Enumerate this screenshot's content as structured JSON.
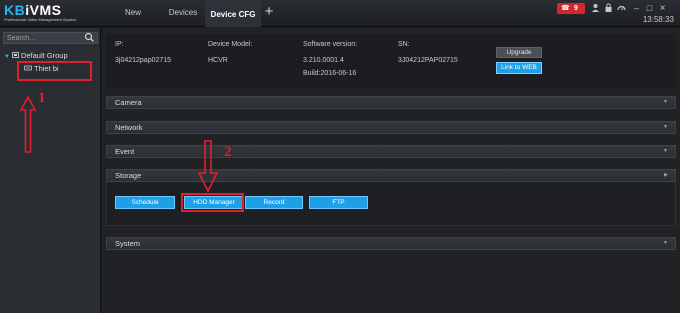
{
  "app": {
    "logo_main_k": "KB",
    "logo_main_rest": "iVMS",
    "logo_sub": "Professional Video Management System"
  },
  "tabs": [
    {
      "label": "New"
    },
    {
      "label": "Devices"
    },
    {
      "label": "Device CFG"
    }
  ],
  "topbar": {
    "add_tab": "+",
    "alarm_count": "9",
    "clock": "13:58:33"
  },
  "sidebar": {
    "search_placeholder": "Search...",
    "group_label": "Default Group",
    "device_label": "Thiet bi"
  },
  "device_info": {
    "ip_label": "IP:",
    "ip_value": "3j04212pap02715",
    "model_label": "Device Model:",
    "model_value": "HCVR",
    "sw_label": "Software version:",
    "sw_value": "3.210.0001.4",
    "build_value": "Build:2016-06-16",
    "sn_label": "SN:",
    "sn_value": "3J04212PAP02715",
    "upgrade_label": "Upgrade",
    "web_label": "Link to WEB"
  },
  "sections": [
    {
      "title": "Camera"
    },
    {
      "title": "Network"
    },
    {
      "title": "Event"
    },
    {
      "title": "Storage"
    },
    {
      "title": "System"
    }
  ],
  "storage_buttons": [
    {
      "label": "Schedule"
    },
    {
      "label": "HDD Manager"
    },
    {
      "label": "Record"
    },
    {
      "label": "FTP"
    }
  ],
  "annotations": {
    "step1": "1",
    "step2": "2",
    "color": "#e0202a"
  },
  "colors": {
    "accent": "#1da0e8",
    "alarm": "#d3262d",
    "background": "#202226"
  }
}
